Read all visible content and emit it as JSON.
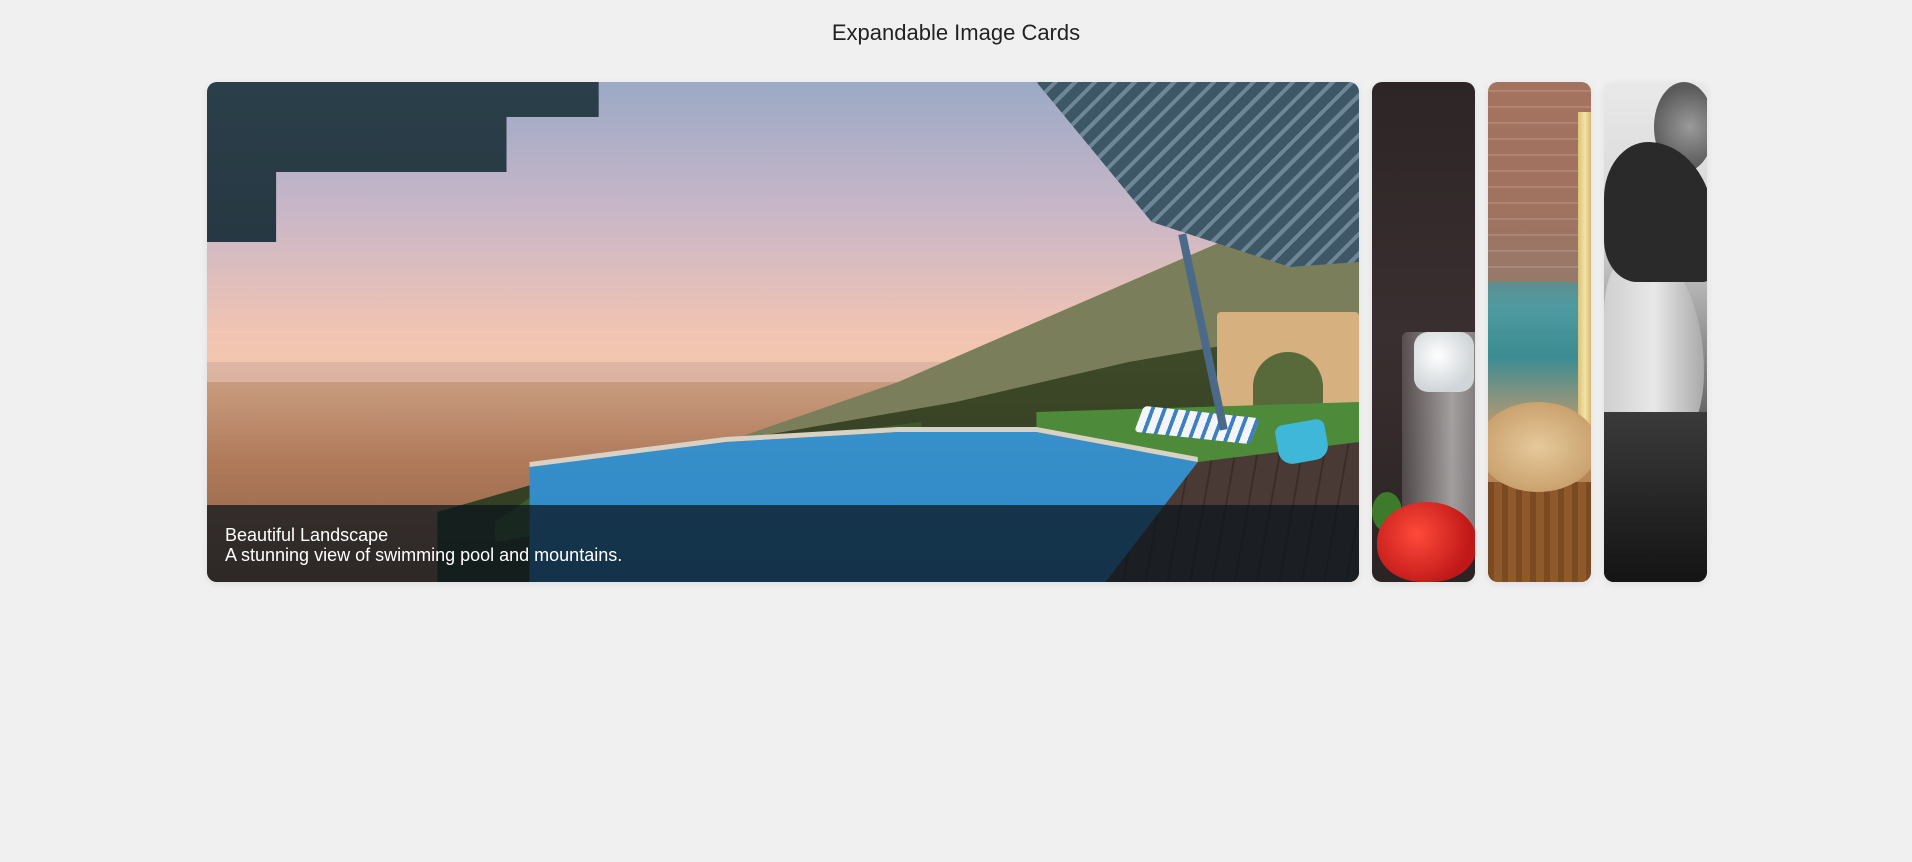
{
  "page": {
    "title": "Expandable Image Cards"
  },
  "cards": [
    {
      "id": "landscape",
      "expanded": true,
      "title": "Beautiful Landscape",
      "description": "A stunning view of swimming pool and mountains."
    },
    {
      "id": "drink",
      "expanded": false
    },
    {
      "id": "cafe",
      "expanded": false
    },
    {
      "id": "portrait",
      "expanded": false
    }
  ],
  "colors": {
    "page_background": "#f0f0f0",
    "caption_overlay": "#0a141c"
  }
}
